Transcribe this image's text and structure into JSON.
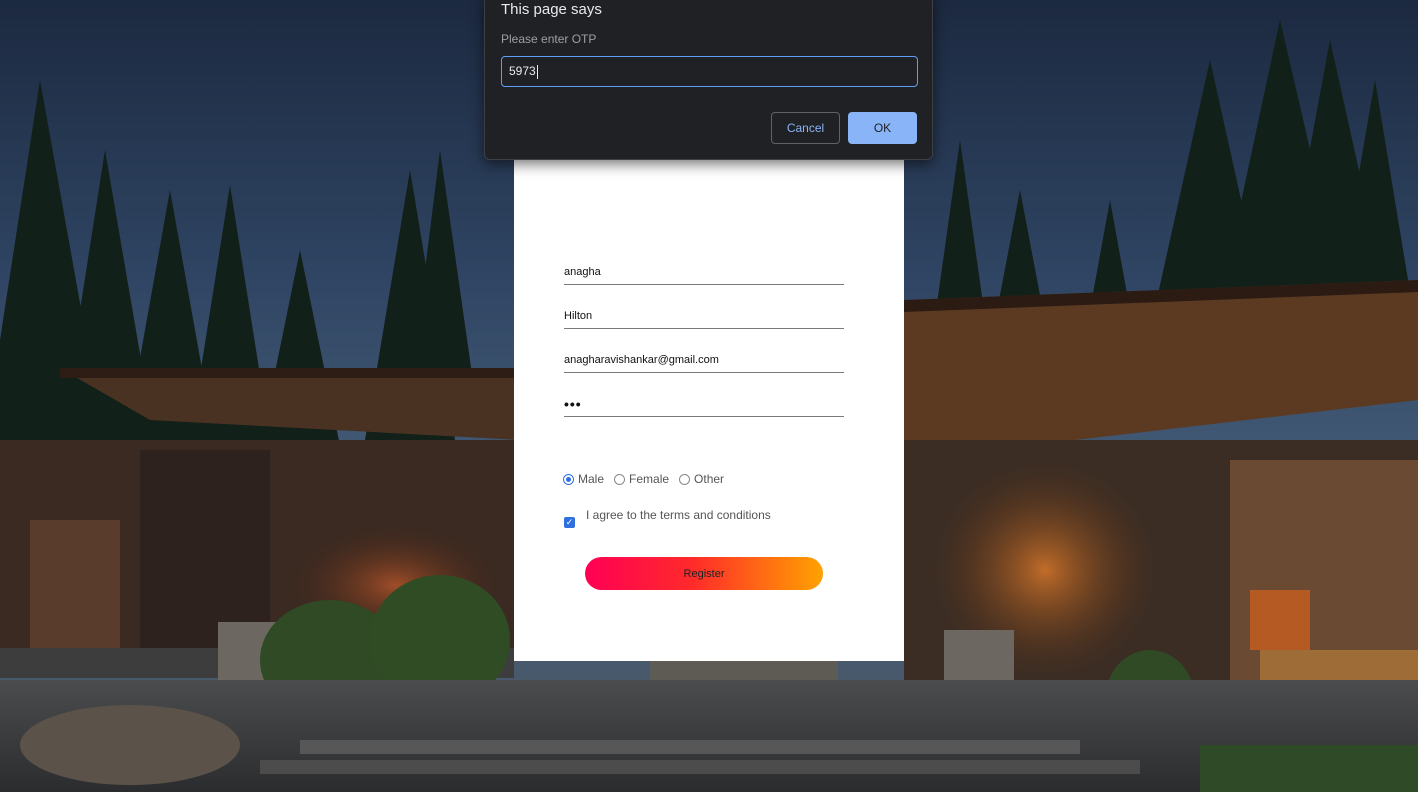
{
  "dialog": {
    "title": "This page says",
    "message": "Please enter OTP",
    "input_value": "5973",
    "cancel_label": "Cancel",
    "ok_label": "OK"
  },
  "form": {
    "first_name": "anagha",
    "last_name": "Hilton",
    "email": "anagharavishankar@gmail.com",
    "password_mask": "•••",
    "gender_options": [
      "Male",
      "Female",
      "Other"
    ],
    "gender_selected": "Male",
    "terms_label": "I agree to the terms and conditions",
    "terms_checked": true,
    "register_label": "Register"
  },
  "colors": {
    "accent": "#2f6fe0",
    "dialog_bg": "#202124",
    "dialog_button": "#8ab4f8",
    "register_gradient_start": "#ff0055",
    "register_gradient_end": "#ffa200"
  },
  "icons": {
    "checkbox": "check-icon",
    "radio": "radio-icon"
  }
}
